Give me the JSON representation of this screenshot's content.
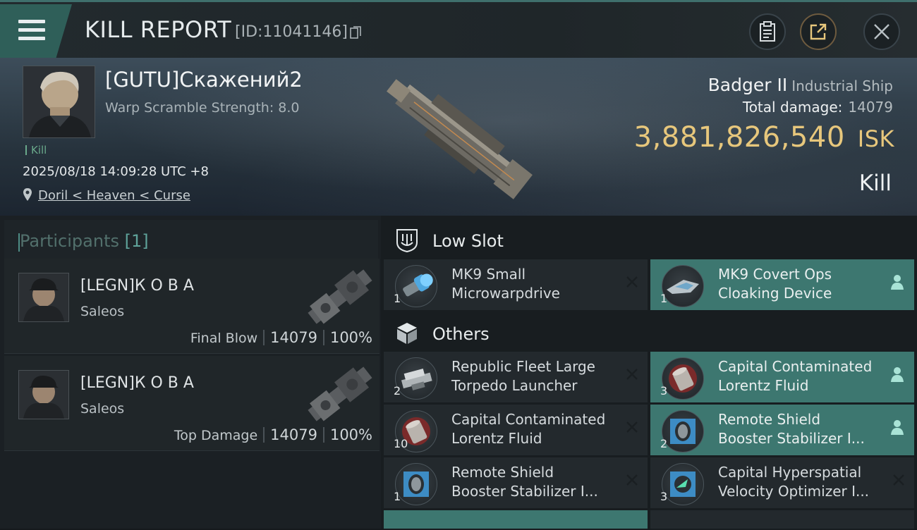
{
  "header": {
    "title": "KILL REPORT",
    "id_text": "[ID:11041146]"
  },
  "victim": {
    "name": "[GUTU]Скажений2",
    "warp_scramble": "Warp Scramble Strength: 8.0",
    "kill_tag": "Kill",
    "datetime": "2025/08/18 14:09:28 UTC +8",
    "location": "Doril < Heaven < Curse"
  },
  "ship": {
    "name": "Badger II",
    "class": "Industrial Ship",
    "total_damage_label": "Total damage:",
    "total_damage": "14079",
    "isk_value": "3,881,826,540",
    "isk_unit": "ISK",
    "result": "Kill"
  },
  "participants": {
    "label": "Participants",
    "count": "[1]",
    "rows": [
      {
        "name": "[LEGN]К О В А",
        "ship": "Saleos",
        "role": "Final Blow",
        "damage": "14079",
        "percent": "100%"
      },
      {
        "name": "[LEGN]К О В А",
        "ship": "Saleos",
        "role": "Top Damage",
        "damage": "14079",
        "percent": "100%"
      }
    ]
  },
  "sections": {
    "low_slot": "Low Slot",
    "others": "Others"
  },
  "items": {
    "low_slot": [
      {
        "qty": "1",
        "line1": "MK9 Small",
        "line2": "Microwarpdrive",
        "state": "destroyed",
        "icon": "microwarpdrive-icon"
      },
      {
        "qty": "1",
        "line1": "MK9 Covert Ops",
        "line2": "Cloaking Device",
        "state": "dropped",
        "icon": "cloaking-device-icon"
      }
    ],
    "others": [
      {
        "qty": "2",
        "line1": "Republic Fleet Large",
        "line2": "Torpedo Launcher",
        "state": "destroyed",
        "icon": "torpedo-launcher-icon"
      },
      {
        "qty": "3",
        "line1": "Capital Contaminated",
        "line2": "Lorentz Fluid",
        "state": "dropped",
        "icon": "lorentz-fluid-icon"
      },
      {
        "qty": "10",
        "line1": "Capital Contaminated",
        "line2": "Lorentz Fluid",
        "state": "destroyed",
        "icon": "lorentz-fluid-icon"
      },
      {
        "qty": "2",
        "line1": "Remote Shield",
        "line2": "Booster Stabilizer I...",
        "state": "dropped",
        "icon": "shield-booster-icon"
      },
      {
        "qty": "1",
        "line1": "Remote Shield",
        "line2": "Booster Stabilizer I...",
        "state": "destroyed",
        "icon": "shield-booster-icon"
      },
      {
        "qty": "3",
        "line1": "Capital Hyperspatial",
        "line2": "Velocity Optimizer I...",
        "state": "destroyed",
        "icon": "velocity-optimizer-icon"
      }
    ]
  },
  "colors": {
    "accent_teal": "#3d7770",
    "isk_gold": "#e7c77c",
    "kill_green": "#6aa98b"
  }
}
